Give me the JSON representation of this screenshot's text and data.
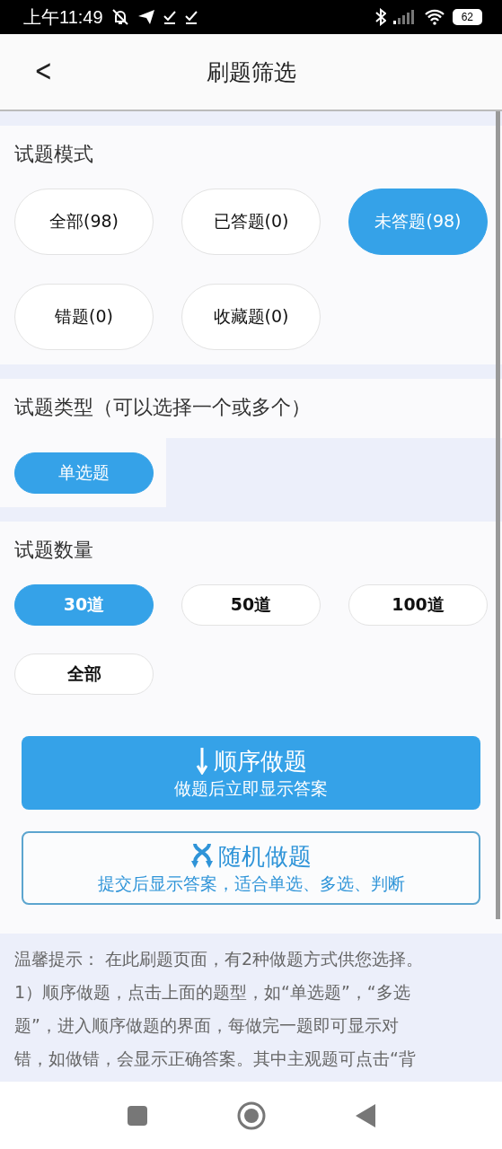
{
  "status_bar": {
    "time": "上午11:49",
    "battery": "62"
  },
  "header": {
    "back": "<",
    "title": "刷题筛选"
  },
  "mode": {
    "title": "试题模式",
    "options": [
      {
        "label": "全部(98)",
        "selected": false
      },
      {
        "label": "已答题(0)",
        "selected": false
      },
      {
        "label": "未答题(98)",
        "selected": true
      },
      {
        "label": "错题(0)",
        "selected": false
      },
      {
        "label": "收藏题(0)",
        "selected": false
      }
    ]
  },
  "type": {
    "title": "试题类型（可以选择一个或多个）",
    "options": [
      {
        "label": "单选题",
        "selected": true
      }
    ]
  },
  "count": {
    "title": "试题数量",
    "options": [
      {
        "label": "30道",
        "selected": true
      },
      {
        "label": "50道",
        "selected": false
      },
      {
        "label": "100道",
        "selected": false
      },
      {
        "label": "全部",
        "selected": false
      }
    ]
  },
  "actions": [
    {
      "kind": "sequential",
      "title": "顺序做题",
      "subtitle": "做题后立即显示答案"
    },
    {
      "kind": "random",
      "title": "随机做题",
      "subtitle": "提交后显示答案，适合单选、多选、判断"
    }
  ],
  "tip": [
    "温馨提示： 在此刷题页面，有2种做题方式供您选择。",
    "1）顺序做题，点击上面的题型，如“单选题”，“多选",
    "题”，进入顺序做题的界面，每做完一题即可显示对",
    "错，如做错，会显示正确答案。其中主观题可点击“背"
  ]
}
